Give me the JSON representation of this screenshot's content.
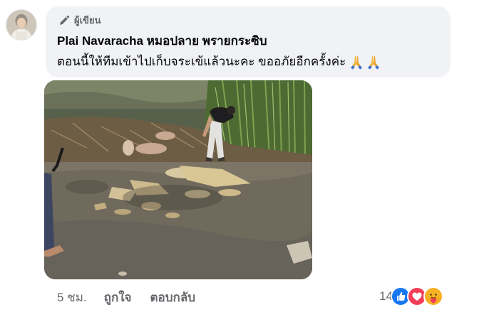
{
  "comment": {
    "author_badge": "ผู้เขียน",
    "author_name": "Plai Navaracha หมอปลาย พรายกระซิบ",
    "text": "ตอนนี้ให้ทีมเข้าไปเก็บจระเข้แล้วนะคะ ขออภัยอีกครั้งค่ะ",
    "emojis": [
      "pray-emoji",
      "pray-emoji"
    ]
  },
  "actions": {
    "timestamp": "5 ชม.",
    "like_label": "ถูกใจ",
    "reply_label": "ตอบกลับ"
  },
  "reactions": {
    "count": "14",
    "types": [
      "like",
      "love",
      "care"
    ]
  },
  "colors": {
    "bubble_bg": "#f0f2f5",
    "secondary_text": "#65676b",
    "like_blue": "#1877f2",
    "love_red": "#f33e58",
    "care_yellow": "#f7b125"
  }
}
